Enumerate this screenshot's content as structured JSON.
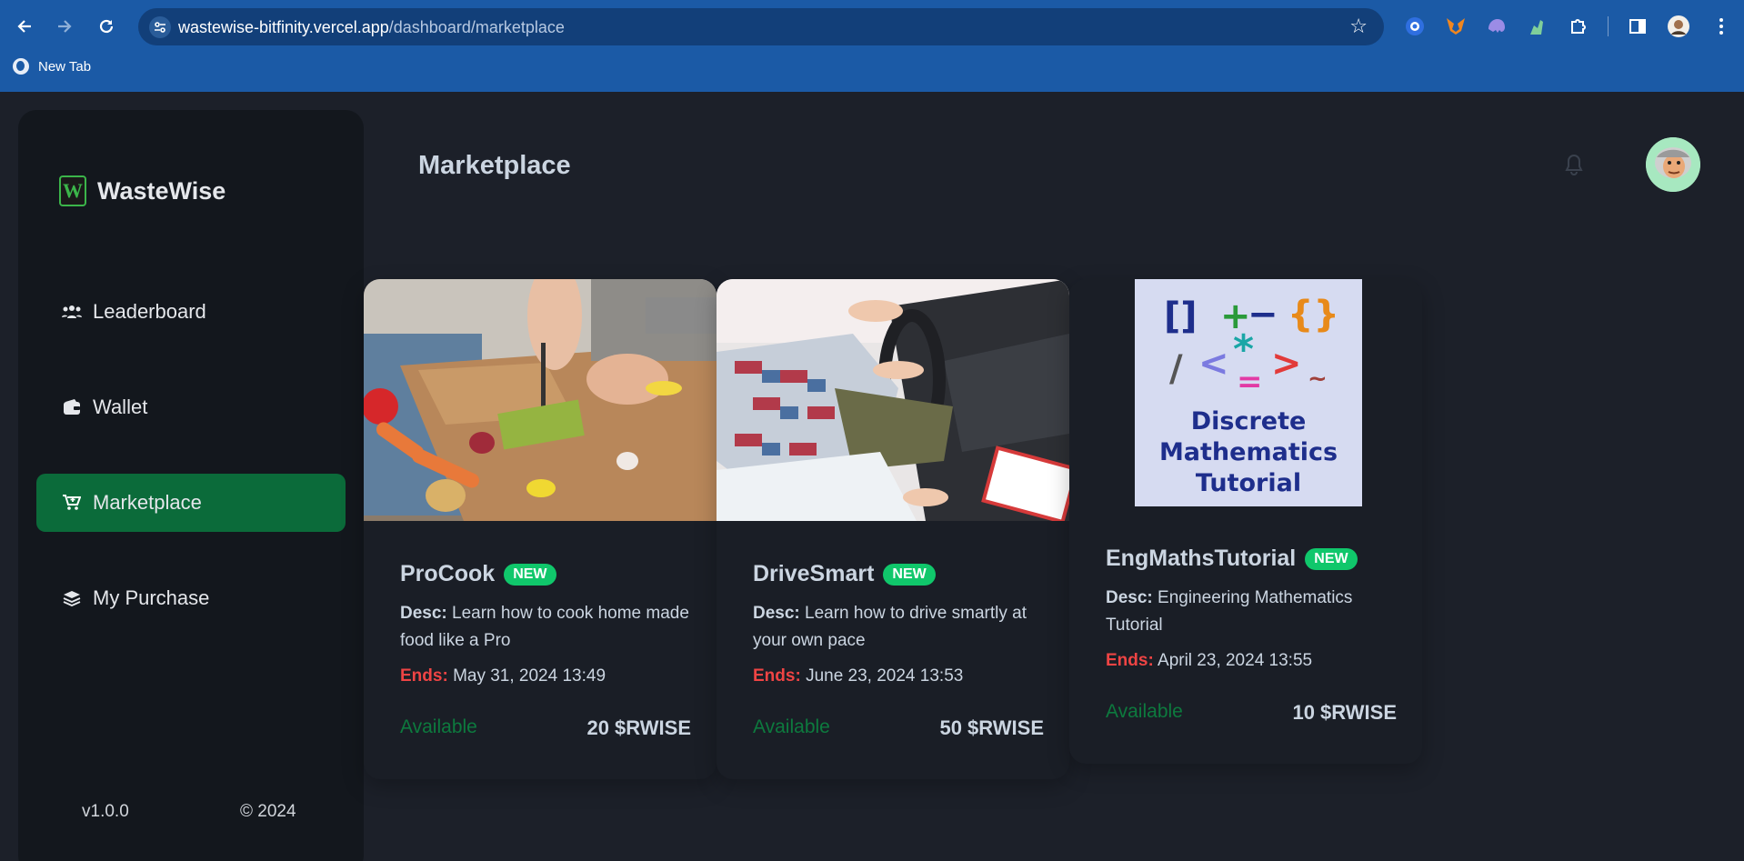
{
  "browser": {
    "url_host": "wastewise-bitfinity.vercel.app",
    "url_path": "/dashboard/marketplace",
    "bookmark_label": "New Tab"
  },
  "sidebar": {
    "brand": "WasteWise",
    "items": [
      {
        "label": "Leaderboard",
        "icon": "users-icon",
        "active": false
      },
      {
        "label": "Wallet",
        "icon": "wallet-icon",
        "active": false
      },
      {
        "label": "Marketplace",
        "icon": "cart-icon",
        "active": true
      },
      {
        "label": "My Purchase",
        "icon": "layers-icon",
        "active": false
      }
    ],
    "version": "v1.0.0",
    "copyright": "© 2024"
  },
  "header": {
    "title": "Marketplace"
  },
  "colors": {
    "accent_green": "#0b6b3a",
    "badge_green": "#10c76b",
    "ends_red": "#ef4444",
    "available_green": "#0d7a3e",
    "browser_blue": "#1b5aa6"
  },
  "cards": [
    {
      "title": "ProCook",
      "badge": "NEW",
      "desc_label": "Desc:",
      "desc": "Learn how to cook home made food like a Pro",
      "ends_label": "Ends:",
      "ends": "May 31, 2024 13:49",
      "status": "Available",
      "price": "20 $RWISE"
    },
    {
      "title": "DriveSmart",
      "badge": "NEW",
      "desc_label": "Desc:",
      "desc": "Learn how to drive smartly at your own pace",
      "ends_label": "Ends:",
      "ends": "June 23, 2024 13:53",
      "status": "Available",
      "price": "50 $RWISE"
    },
    {
      "title": "EngMathsTutorial",
      "badge": "NEW",
      "desc_label": "Desc:",
      "desc": "Engineering Mathematics Tutorial",
      "ends_label": "Ends:",
      "ends": "April 23, 2024 13:55",
      "status": "Available",
      "price": "10 $RWISE",
      "image_text": [
        "[]",
        "+",
        "−",
        "{}",
        "/",
        "<",
        "*",
        "=",
        ">",
        "~",
        "Discrete",
        "Mathematics",
        "Tutorial"
      ]
    }
  ]
}
